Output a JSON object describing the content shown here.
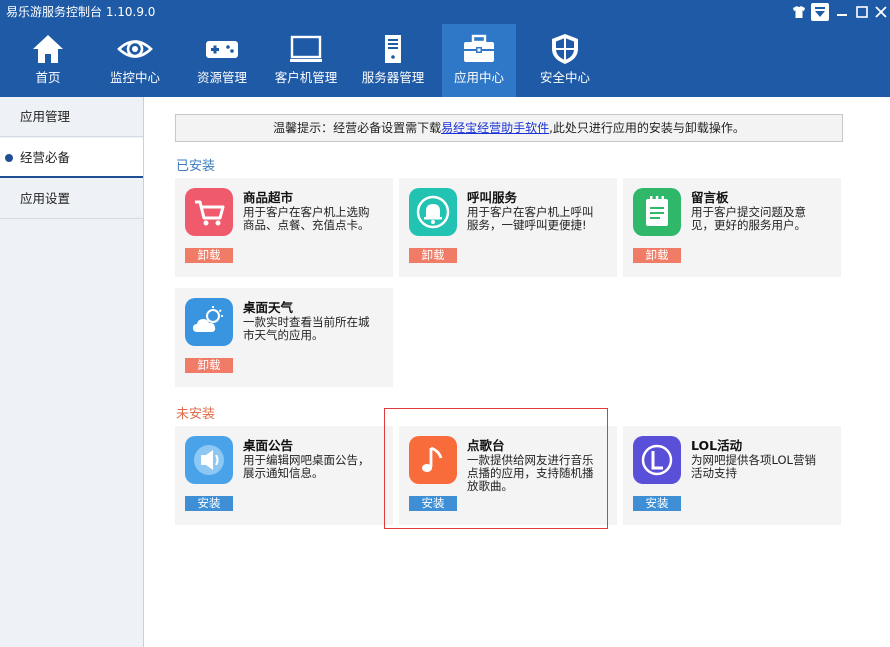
{
  "window": {
    "title": "易乐游服务控制台 1.10.9.0"
  },
  "toolbar": {
    "items": [
      {
        "label": "首页",
        "icon": "home-icon"
      },
      {
        "label": "监控中心",
        "icon": "eye-icon"
      },
      {
        "label": "资源管理",
        "icon": "gamepad-icon"
      },
      {
        "label": "客户机管理",
        "icon": "monitor-icon"
      },
      {
        "label": "服务器管理",
        "icon": "server-icon"
      },
      {
        "label": "应用中心",
        "icon": "toolbox-icon",
        "active": true
      },
      {
        "label": "安全中心",
        "icon": "shield-icon"
      }
    ]
  },
  "sidebar": {
    "items": [
      {
        "label": "应用管理"
      },
      {
        "label": "经营必备",
        "active": true
      },
      {
        "label": "应用设置"
      }
    ]
  },
  "notice": {
    "prefix": "温馨提示：经营必备设置需下载",
    "link": "易经宝经营助手软件",
    "suffix": ",此处只进行应用的安装与卸载操作。"
  },
  "sections": {
    "installed": {
      "label": "已安装",
      "apps": [
        {
          "name": "商品超市",
          "desc": "用于客户在客户机上选购商品、点餐、充值点卡。",
          "button": "卸载",
          "icon": "shopping-cart-icon",
          "color": "#ef5b6c"
        },
        {
          "name": "呼叫服务",
          "desc": "用于客户在客户机上呼叫服务，一键呼叫更便捷!",
          "button": "卸载",
          "icon": "bell-icon",
          "color": "#23c3b3"
        },
        {
          "name": "留言板",
          "desc": "用于客户提交问题及意见，更好的服务用户。",
          "button": "卸载",
          "icon": "notepad-icon",
          "color": "#2fb76a"
        },
        {
          "name": "桌面天气",
          "desc": "一款实时查看当前所在城市天气的应用。",
          "button": "卸载",
          "icon": "weather-icon",
          "color": "#3a95e0"
        }
      ]
    },
    "notinstalled": {
      "label": "未安装",
      "apps": [
        {
          "name": "桌面公告",
          "desc": "用于编辑网吧桌面公告，展示通知信息。",
          "button": "安装",
          "icon": "speaker-icon",
          "color": "#4aa3e8"
        },
        {
          "name": "点歌台",
          "desc": "一款提供给网友进行音乐点播的应用，支持随机播放歌曲。",
          "button": "安装",
          "icon": "music-note-icon",
          "color": "#f86b3a"
        },
        {
          "name": "LOL活动",
          "desc": "为网吧提供各项LOL营销活动支持",
          "button": "安装",
          "icon": "lol-icon",
          "color": "#5a4fd8"
        }
      ]
    }
  }
}
